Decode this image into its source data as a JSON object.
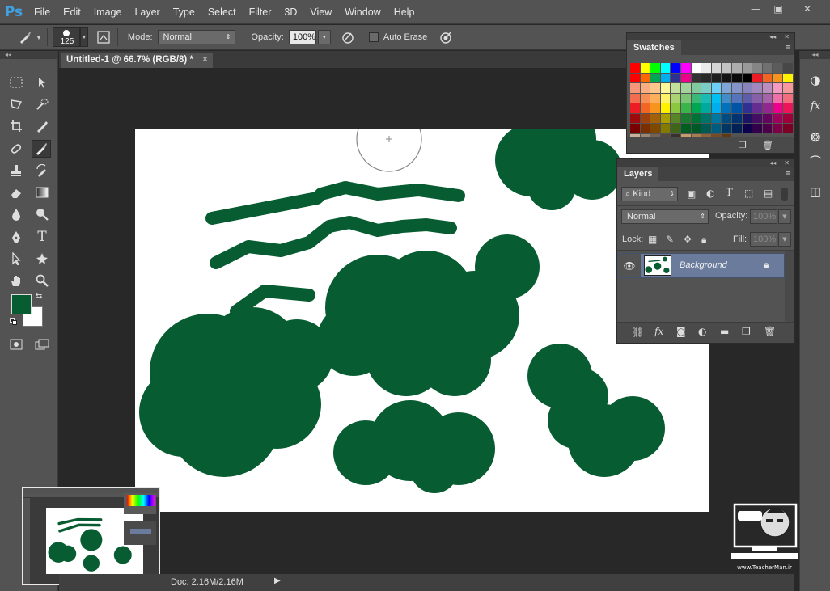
{
  "app": {
    "logo": "Ps"
  },
  "menu": [
    "File",
    "Edit",
    "Image",
    "Layer",
    "Type",
    "Select",
    "Filter",
    "3D",
    "View",
    "Window",
    "Help"
  ],
  "window_controls": {
    "minimize": "—",
    "restore": "▣",
    "close": "✕"
  },
  "options": {
    "brush_size": "125",
    "mode_label": "Mode:",
    "mode_value": "Normal",
    "opacity_label": "Opacity:",
    "opacity_value": "100%",
    "auto_erase_label": "Auto Erase",
    "auto_erase_checked": false
  },
  "document": {
    "tab_title": "Untitled-1 @ 66.7% (RGB/8) *",
    "close": "×"
  },
  "colors": {
    "foreground": "#085c31",
    "background": "#ffffff",
    "paint": "#085c31"
  },
  "swatches": {
    "title": "Swatches",
    "rows": [
      [
        "#ff0000",
        "#ffff00",
        "#00ff00",
        "#00ffff",
        "#0000ff",
        "#ff00ff",
        "#ffffff",
        "#ebebeb",
        "#d6d6d6",
        "#c2c2c2",
        "#adadad",
        "#999999",
        "#858585",
        "#707070",
        "#5c5c5c",
        "#474747"
      ],
      [
        "#ff0000",
        "#ff6600",
        "#00a651",
        "#00aeef",
        "#2e3192",
        "#ec008c",
        "#333333",
        "#292929",
        "#1f1f1f",
        "#141414",
        "#0a0a0a",
        "#000000",
        "#ed1c24",
        "#f26522",
        "#f7941d",
        "#fff200"
      ],
      [
        "#f7977a",
        "#f9ad81",
        "#fdc68a",
        "#fff79a",
        "#c4df9b",
        "#a3d39c",
        "#82ca9d",
        "#7bcdc8",
        "#6ecff6",
        "#7ea7d8",
        "#8493ca",
        "#8882be",
        "#a187be",
        "#bc8dbf",
        "#f49ac2",
        "#f6989d"
      ],
      [
        "#f26c4f",
        "#f68e55",
        "#fbaf5c",
        "#fff467",
        "#acd372",
        "#7cc576",
        "#3bb878",
        "#1abbb4",
        "#00bff3",
        "#438cca",
        "#5574b9",
        "#605ca8",
        "#855fa8",
        "#a763a8",
        "#f06ea9",
        "#f26d7d"
      ],
      [
        "#ed1c24",
        "#f26522",
        "#f7941d",
        "#fff200",
        "#8dc73f",
        "#39b54a",
        "#00a651",
        "#00a99d",
        "#00aeef",
        "#0072bc",
        "#0054a6",
        "#2e3192",
        "#662d91",
        "#92278f",
        "#ec008c",
        "#ed145b"
      ],
      [
        "#9e0b0f",
        "#a0410d",
        "#a36209",
        "#aba000",
        "#598527",
        "#1a7b30",
        "#007236",
        "#00746b",
        "#0076a3",
        "#004b80",
        "#003471",
        "#1b1464",
        "#440e62",
        "#630460",
        "#9e005d",
        "#9e0039"
      ],
      [
        "#790000",
        "#7b2e00",
        "#7d4900",
        "#827b00",
        "#406618",
        "#005e20",
        "#005826",
        "#005952",
        "#005b7f",
        "#003663",
        "#002157",
        "#0d004c",
        "#32004b",
        "#4b0049",
        "#7b0046",
        "#7a0026"
      ],
      [
        "#c7b299",
        "#998675",
        "#736357",
        "#534741",
        "#37302d",
        "#c69c6d",
        "#a67c52",
        "#8c6239",
        "#754c24",
        "#603913",
        "",
        "",
        "",
        "",
        "",
        ""
      ]
    ]
  },
  "layers": {
    "title": "Layers",
    "filter_label": "Kind",
    "blend_mode": "Normal",
    "opacity_label": "Opacity:",
    "opacity_value": "100%",
    "lock_label": "Lock:",
    "fill_label": "Fill:",
    "fill_value": "100%",
    "items": [
      {
        "name": "Background",
        "visible": true,
        "locked": true
      }
    ]
  },
  "status": {
    "doc": "Doc: 2.16M/2.16M"
  }
}
